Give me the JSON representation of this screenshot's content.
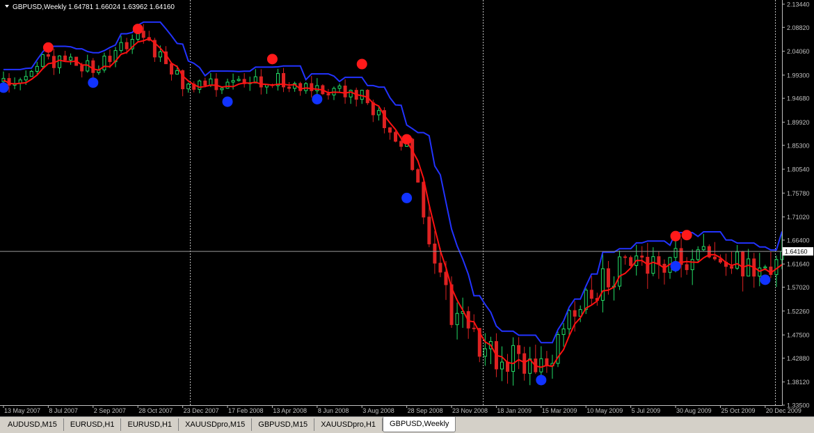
{
  "window": {
    "symbol_title": "GBPUSD,Weekly",
    "ohlc_readout": "1.64781 1.66024 1.63962 1.64160",
    "menu_arrow": "triangle-down-icon"
  },
  "price_axis": {
    "ticks": [
      "2.13440",
      "2.08820",
      "2.04060",
      "1.99300",
      "1.94680",
      "1.89920",
      "1.85300",
      "1.80540",
      "1.75780",
      "1.71020",
      "1.66400",
      "1.61640",
      "1.57020",
      "1.52260",
      "1.47500",
      "1.42880",
      "1.38120",
      "1.33500"
    ],
    "current_price": "1.64160"
  },
  "time_axis": {
    "labels": [
      "13 May 2007",
      "8 Jul 2007",
      "2 Sep 2007",
      "28 Oct 2007",
      "23 Dec 2007",
      "17 Feb 2008",
      "13 Apr 2008",
      "8 Jun 2008",
      "3 Aug 2008",
      "28 Sep 2008",
      "23 Nov 2008",
      "18 Jan 2009",
      "15 Mar 2009",
      "10 May 2009",
      "5 Jul 2009",
      "30 Aug 2009",
      "25 Oct 2009",
      "20 Dec 2009"
    ]
  },
  "tabs": [
    {
      "label": "AUDUSD,M15",
      "active": false
    },
    {
      "label": "EURUSD,H1",
      "active": false
    },
    {
      "label": "EURUSD,H1",
      "active": false
    },
    {
      "label": "XAUUSDpro,M15",
      "active": false
    },
    {
      "label": "GBPUSD,M15",
      "active": false
    },
    {
      "label": "XAUUSDpro,H1",
      "active": false
    },
    {
      "label": "GBPUSD,Weekly",
      "active": true
    }
  ],
  "colors": {
    "background": "#000000",
    "bull_candle": "#22dd66",
    "bear_candle": "#dd2222",
    "upper_band": "#2233ff",
    "lower_band": "#ff1111",
    "peak_marker": "#ff1a1a",
    "trough_marker": "#1133ff",
    "grid_separator": "#c0c0c0",
    "axis_text": "#c0c0c0",
    "current_price_line": "#9a9a9a"
  },
  "chart_data": {
    "type": "candlestick",
    "symbol": "GBPUSD",
    "timeframe": "Weekly",
    "ylim": [
      1.335,
      2.1344
    ],
    "x_range": [
      "13 May 2007",
      "10 Jan 2010"
    ],
    "current_price": 1.6416,
    "price_curve": [
      [
        "13 May 2007",
        1.98
      ],
      [
        "8 Jul 2007",
        2.025
      ],
      [
        "2 Sep 2007",
        2.01
      ],
      [
        "28 Oct 2007",
        2.075
      ],
      [
        "23 Dec 2007",
        1.98
      ],
      [
        "17 Feb 2008",
        1.965
      ],
      [
        "13 Apr 2008",
        1.985
      ],
      [
        "8 Jun 2008",
        1.962
      ],
      [
        "3 Aug 2008",
        1.955
      ],
      [
        "28 Sep 2008",
        1.85
      ],
      [
        "23 Nov 2008",
        1.52
      ],
      [
        "18 Jan 2009",
        1.43
      ],
      [
        "15 Mar 2009",
        1.41
      ],
      [
        "10 May 2009",
        1.55
      ],
      [
        "5 Jul 2009",
        1.63
      ],
      [
        "30 Aug 2009",
        1.62
      ],
      [
        "25 Oct 2009",
        1.63
      ],
      [
        "20 Dec 2009",
        1.6
      ],
      [
        "10 Jan 2010",
        1.6416
      ]
    ],
    "band_markers": {
      "peaks": [
        [
          "8 Jul 2007",
          2.048
        ],
        [
          "28 Oct 2007",
          2.085
        ],
        [
          "13 Apr 2008",
          2.025
        ],
        [
          "3 Aug 2008",
          2.015
        ],
        [
          "28 Sep 2008",
          1.865
        ],
        [
          "30 Aug 2009",
          1.672
        ],
        [
          "13 Sep 2009",
          1.674
        ]
      ],
      "troughs": [
        [
          "13 May 2007",
          1.968
        ],
        [
          "2 Sep 2007",
          1.978
        ],
        [
          "17 Feb 2008",
          1.94
        ],
        [
          "8 Jun 2008",
          1.945
        ],
        [
          "28 Sep 2008",
          1.748
        ],
        [
          "15 Mar 2009",
          1.385
        ],
        [
          "30 Aug 2009",
          1.612
        ],
        [
          "20 Dec 2009",
          1.585
        ]
      ]
    }
  }
}
